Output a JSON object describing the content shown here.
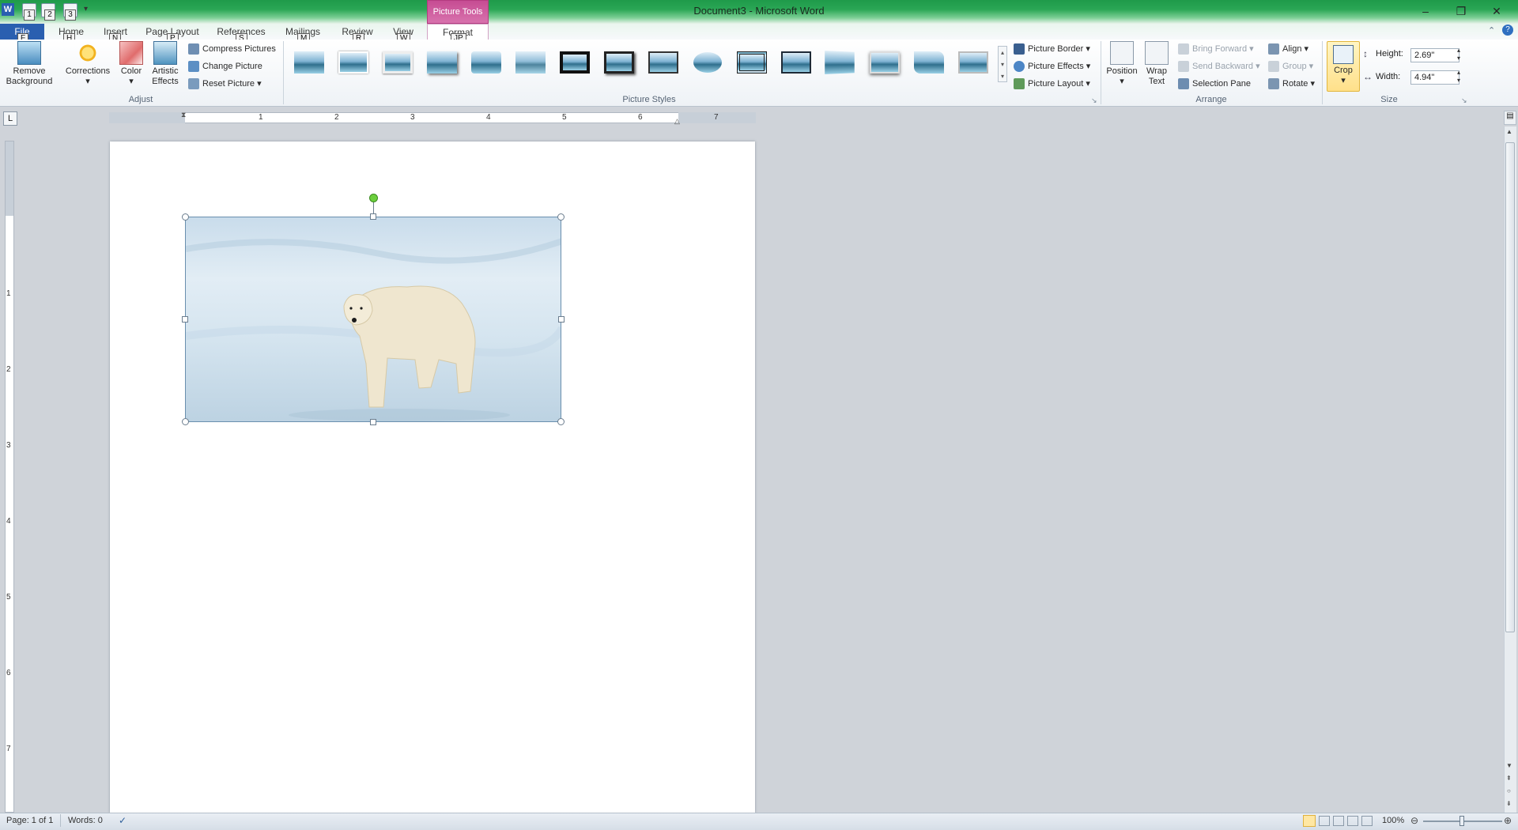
{
  "window": {
    "title": "Document3 - Microsoft Word",
    "contextual_tab_group": "Picture Tools",
    "controls": [
      "minimize",
      "restore",
      "close"
    ]
  },
  "qat": {
    "keytips": [
      "1",
      "2",
      "3"
    ]
  },
  "tabs": [
    {
      "label": "File",
      "keytip": "F"
    },
    {
      "label": "Home",
      "keytip": "H"
    },
    {
      "label": "Insert",
      "keytip": "N"
    },
    {
      "label": "Page Layout",
      "keytip": "P"
    },
    {
      "label": "References",
      "keytip": "S"
    },
    {
      "label": "Mailings",
      "keytip": "M"
    },
    {
      "label": "Review",
      "keytip": "R"
    },
    {
      "label": "View",
      "keytip": "W"
    },
    {
      "label": "Format",
      "keytip": "JP"
    }
  ],
  "ribbon": {
    "adjust": {
      "label": "Adjust",
      "remove_background": "Remove Background",
      "corrections": "Corrections",
      "color": "Color",
      "artistic_effects": "Artistic Effects",
      "compress_pictures": "Compress Pictures",
      "change_picture": "Change Picture",
      "reset_picture": "Reset Picture"
    },
    "picture_styles": {
      "label": "Picture Styles",
      "picture_border": "Picture Border",
      "picture_effects": "Picture Effects",
      "picture_layout": "Picture Layout"
    },
    "arrange": {
      "label": "Arrange",
      "position": "Position",
      "wrap_text": "Wrap Text",
      "bring_forward": "Bring Forward",
      "send_backward": "Send Backward",
      "selection_pane": "Selection Pane",
      "align": "Align",
      "group": "Group",
      "rotate": "Rotate"
    },
    "size": {
      "label": "Size",
      "crop": "Crop",
      "height_label": "Height:",
      "height_value": "2.69\"",
      "width_label": "Width:",
      "width_value": "4.94\""
    }
  },
  "ruler": {
    "h_numbers": [
      "1",
      "2",
      "3",
      "4",
      "5",
      "6",
      "7"
    ],
    "v_numbers": [
      "1",
      "2",
      "3",
      "4",
      "5",
      "6",
      "7"
    ]
  },
  "status": {
    "page": "Page: 1 of 1",
    "words": "Words: 0",
    "zoom": "100%"
  },
  "colors": {
    "title_bar": "#2aa655",
    "picture_tools": "#c64c93",
    "file_tab": "#2a5fb0"
  }
}
